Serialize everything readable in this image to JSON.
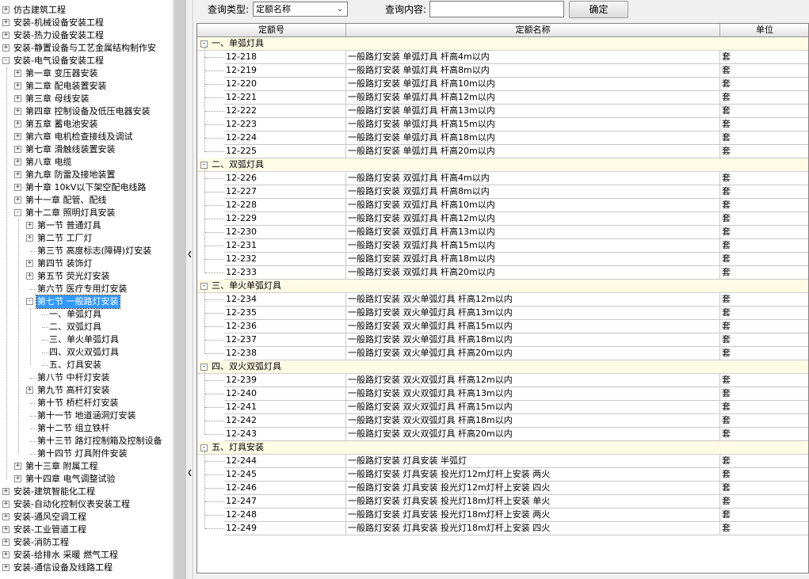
{
  "tree": {
    "items": [
      {
        "label": "仿古建筑工程",
        "level": 0,
        "box": "+"
      },
      {
        "label": "安装-机械设备安装工程",
        "level": 0,
        "box": "+"
      },
      {
        "label": "安装-热力设备安装工程",
        "level": 0,
        "box": "+"
      },
      {
        "label": "安装-静置设备与工艺金属结构制作安",
        "level": 0,
        "box": "+"
      },
      {
        "label": "安装-电气设备安装工程",
        "level": 0,
        "box": "-"
      },
      {
        "label": "第一章  变压器安装",
        "level": 1,
        "box": "+"
      },
      {
        "label": "第二章  配电装置安装",
        "level": 1,
        "box": "+"
      },
      {
        "label": "第三章  母线安装",
        "level": 1,
        "box": "+"
      },
      {
        "label": "第四章  控制设备及低压电器安装",
        "level": 1,
        "box": "+"
      },
      {
        "label": "第五章  蓄电池安装",
        "level": 1,
        "box": "+"
      },
      {
        "label": "第六章  电机检查接线及调试",
        "level": 1,
        "box": "+"
      },
      {
        "label": "第七章  滑触线装置安装",
        "level": 1,
        "box": "+"
      },
      {
        "label": "第八章  电缆",
        "level": 1,
        "box": "+"
      },
      {
        "label": "第九章  防雷及接地装置",
        "level": 1,
        "box": "+"
      },
      {
        "label": "第十章  10kV以下架空配电线路",
        "level": 1,
        "box": "+"
      },
      {
        "label": "第十一章  配管、配线",
        "level": 1,
        "box": "+"
      },
      {
        "label": "第十二章  照明灯具安装",
        "level": 1,
        "box": "-"
      },
      {
        "label": "第一节  普通灯具",
        "level": 2,
        "box": "+"
      },
      {
        "label": "第二节  工厂灯",
        "level": 2,
        "box": "+"
      },
      {
        "label": "第三节  高度标志(障碍)灯安装",
        "level": 2,
        "box": ""
      },
      {
        "label": "第四节  装饰灯",
        "level": 2,
        "box": "+"
      },
      {
        "label": "第五节  荧光灯安装",
        "level": 2,
        "box": "+"
      },
      {
        "label": "第六节  医疗专用灯安装",
        "level": 2,
        "box": ""
      },
      {
        "label": "第七节  一般路灯安装",
        "level": 2,
        "box": "-",
        "selected": true
      },
      {
        "label": "一、单弧灯具",
        "level": 3,
        "box": ""
      },
      {
        "label": "二、双弧灯具",
        "level": 3,
        "box": ""
      },
      {
        "label": "三、单火单弧灯具",
        "level": 3,
        "box": ""
      },
      {
        "label": "四、双火双弧灯具",
        "level": 3,
        "box": ""
      },
      {
        "label": "五、灯具安装",
        "level": 3,
        "box": ""
      },
      {
        "label": "第八节  中杆灯安装",
        "level": 2,
        "box": ""
      },
      {
        "label": "第九节  高杆灯安装",
        "level": 2,
        "box": "+"
      },
      {
        "label": "第十节  桥栏杆灯安装",
        "level": 2,
        "box": ""
      },
      {
        "label": "第十一节  地道涵洞灯安装",
        "level": 2,
        "box": ""
      },
      {
        "label": "第十二节  组立铁杆",
        "level": 2,
        "box": ""
      },
      {
        "label": "第十三节  路灯控制箱及控制设备",
        "level": 2,
        "box": ""
      },
      {
        "label": "第十四节  灯具附件安装",
        "level": 2,
        "box": ""
      },
      {
        "label": "第十三章  附属工程",
        "level": 1,
        "box": "+"
      },
      {
        "label": "第十四章  电气调整试验",
        "level": 1,
        "box": "+"
      },
      {
        "label": "安装-建筑智能化工程",
        "level": 0,
        "box": "+"
      },
      {
        "label": "安装-自动化控制仪表安装工程",
        "level": 0,
        "box": "+"
      },
      {
        "label": "安装-通风空调工程",
        "level": 0,
        "box": "+"
      },
      {
        "label": "安装-工业管道工程",
        "level": 0,
        "box": "+"
      },
      {
        "label": "安装-消防工程",
        "level": 0,
        "box": "+"
      },
      {
        "label": "安装-给排水  采暖  燃气工程",
        "level": 0,
        "box": "+"
      },
      {
        "label": "安装-通信设备及线路工程",
        "level": 0,
        "box": "+"
      }
    ]
  },
  "query": {
    "type_label": "查询类型:",
    "type_value": "定额名称",
    "content_label": "查询内容:",
    "content_value": "",
    "confirm_label": "确定"
  },
  "grid": {
    "headers": [
      "定额号",
      "定额名称",
      "单位"
    ],
    "groups": [
      {
        "name": "一、单弧灯具",
        "rows": [
          [
            "12-218",
            "一般路灯安装 单弧灯具 杆高4m以内",
            "套"
          ],
          [
            "12-219",
            "一般路灯安装 单弧灯具 杆高8m以内",
            "套"
          ],
          [
            "12-220",
            "一般路灯安装 单弧灯具 杆高10m以内",
            "套"
          ],
          [
            "12-221",
            "一般路灯安装 单弧灯具 杆高12m以内",
            "套"
          ],
          [
            "12-222",
            "一般路灯安装 单弧灯具 杆高13m以内",
            "套"
          ],
          [
            "12-223",
            "一般路灯安装 单弧灯具 杆高15m以内",
            "套"
          ],
          [
            "12-224",
            "一般路灯安装 单弧灯具 杆高18m以内",
            "套"
          ],
          [
            "12-225",
            "一般路灯安装 单弧灯具 杆高20m以内",
            "套"
          ]
        ]
      },
      {
        "name": "二、双弧灯具",
        "rows": [
          [
            "12-226",
            "一般路灯安装 双弧灯具 杆高4m以内",
            "套"
          ],
          [
            "12-227",
            "一般路灯安装 双弧灯具 杆高8m以内",
            "套"
          ],
          [
            "12-228",
            "一般路灯安装 双弧灯具 杆高10m以内",
            "套"
          ],
          [
            "12-229",
            "一般路灯安装 双弧灯具 杆高12m以内",
            "套"
          ],
          [
            "12-230",
            "一般路灯安装 双弧灯具 杆高13m以内",
            "套"
          ],
          [
            "12-231",
            "一般路灯安装 双弧灯具 杆高15m以内",
            "套"
          ],
          [
            "12-232",
            "一般路灯安装 双弧灯具 杆高18m以内",
            "套"
          ],
          [
            "12-233",
            "一般路灯安装 双弧灯具 杆高20m以内",
            "套"
          ]
        ]
      },
      {
        "name": "三、单火单弧灯具",
        "rows": [
          [
            "12-234",
            "一般路灯安装 双火单弧灯具 杆高12m以内",
            "套"
          ],
          [
            "12-235",
            "一般路灯安装 双火单弧灯具 杆高13m以内",
            "套"
          ],
          [
            "12-236",
            "一般路灯安装 双火单弧灯具 杆高15m以内",
            "套"
          ],
          [
            "12-237",
            "一般路灯安装 双火单弧灯具 杆高18m以内",
            "套"
          ],
          [
            "12-238",
            "一般路灯安装 双火单弧灯具 杆高20m以内",
            "套"
          ]
        ]
      },
      {
        "name": "四、双火双弧灯具",
        "rows": [
          [
            "12-239",
            "一般路灯安装 双火双弧灯具 杆高12m以内",
            "套"
          ],
          [
            "12-240",
            "一般路灯安装 双火双弧灯具 杆高13m以内",
            "套"
          ],
          [
            "12-241",
            "一般路灯安装 双火双弧灯具 杆高15m以内",
            "套"
          ],
          [
            "12-242",
            "一般路灯安装 双火双弧灯具 杆高18m以内",
            "套"
          ],
          [
            "12-243",
            "一般路灯安装 双火双弧灯具 杆高20m以内",
            "套"
          ]
        ]
      },
      {
        "name": "五、灯具安装",
        "rows": [
          [
            "12-244",
            "一般路灯安装 灯具安装 半弧灯",
            "套"
          ],
          [
            "12-245",
            "一般路灯安装 灯具安装 投光灯12m灯杆上安装 两火",
            "套"
          ],
          [
            "12-246",
            "一般路灯安装 灯具安装 投光灯12m灯杆上安装 四火",
            "套"
          ],
          [
            "12-247",
            "一般路灯安装 灯具安装 投光灯18m灯杆上安装 单火",
            "套"
          ],
          [
            "12-248",
            "一般路灯安装 灯具安装 投光灯18m灯杆上安装 两火",
            "套"
          ],
          [
            "12-249",
            "一般路灯安装 灯具安装 投光灯18m灯杆上安装 四火",
            "套"
          ]
        ]
      }
    ]
  },
  "colors": {
    "selection": "#3399ff",
    "group_bg": "#fffbe5"
  }
}
